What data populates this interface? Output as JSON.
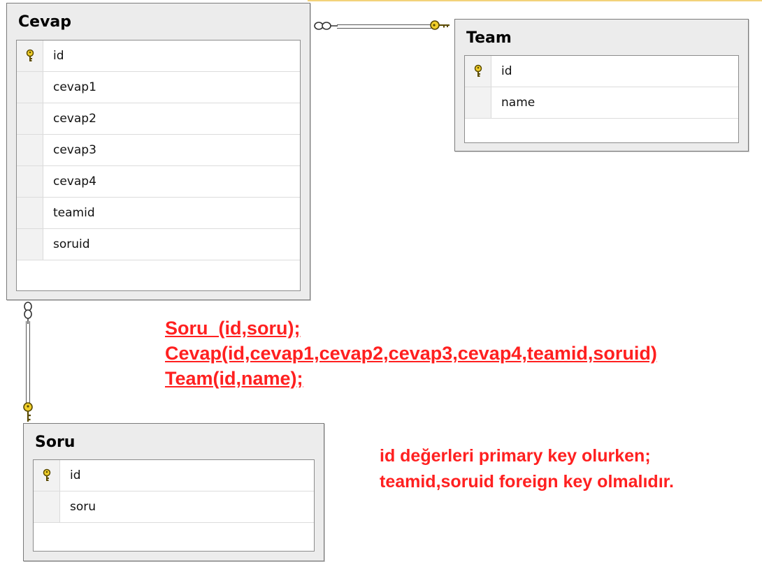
{
  "tables": {
    "cevap": {
      "title": "Cevap",
      "columns": [
        {
          "name": "id",
          "key": true
        },
        {
          "name": "cevap1",
          "key": false
        },
        {
          "name": "cevap2",
          "key": false
        },
        {
          "name": "cevap3",
          "key": false
        },
        {
          "name": "cevap4",
          "key": false
        },
        {
          "name": "teamid",
          "key": false
        },
        {
          "name": "soruid",
          "key": false
        }
      ]
    },
    "team": {
      "title": "Team",
      "columns": [
        {
          "name": "id",
          "key": true
        },
        {
          "name": "name",
          "key": false
        }
      ]
    },
    "soru": {
      "title": "Soru",
      "columns": [
        {
          "name": "id",
          "key": true
        },
        {
          "name": "soru",
          "key": false
        }
      ]
    }
  },
  "schema_lines": [
    "Soru  (id,soru);",
    "Cevap(id,cevap1,cevap2,cevap3,cevap4,teamid,soruid)",
    "Team(id,name);"
  ],
  "note_lines": [
    "id değerleri primary key olurken;",
    "teamid,soruid foreign key olmalıdır."
  ],
  "colors": {
    "annotation": "#ff2020",
    "key": "#e8c000",
    "table_background": "#ececec"
  }
}
